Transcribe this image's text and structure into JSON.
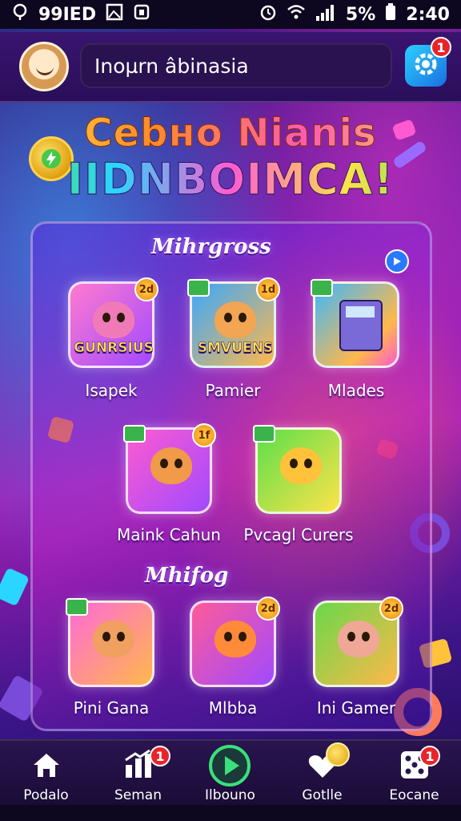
{
  "status_bar": {
    "left_text": "99IED",
    "battery_percent": "5%",
    "time": "2:40"
  },
  "header": {
    "search_value": "Inoµrn âbinasia",
    "settings_badge": "1"
  },
  "hero": {
    "title_line1": "Cebно Nianis",
    "title_line2": "IIDNBOIMCA!"
  },
  "panel": {
    "section1_title": "Mihrgross",
    "section2_title": "Mhifog",
    "games_row1": [
      {
        "label": "Isapek",
        "banner": "GUNRSIUS",
        "badge": "2d",
        "face": "#f07ab8",
        "bg": "#ff7ad0"
      },
      {
        "label": "Pamier",
        "banner": "SMVUENS",
        "badge": "1d",
        "face": "#f2a552",
        "bg": "#3aa8ff"
      },
      {
        "label": "Mlades",
        "banner": "",
        "badge": "",
        "face": "#7a6ad8",
        "bg": "#ffb84a"
      }
    ],
    "games_row2": [
      {
        "label": "Maink Cahun",
        "badge": "1f",
        "face": "#f09a4a",
        "bg": "#ff5ad0"
      },
      {
        "label": "Pvcagl Curers",
        "badge": "",
        "face": "#ffc23a",
        "bg": "#5ae04a"
      }
    ],
    "games_row3": [
      {
        "label": "Pini Gana",
        "badge": "",
        "face": "#f0a060",
        "bg": "#ff6ad8"
      },
      {
        "label": "Mlbba",
        "badge": "2d",
        "face": "#ff8a3a",
        "bg": "#ff5a9a"
      },
      {
        "label": "Ini Gamer",
        "badge": "2d",
        "face": "#f0a896",
        "bg": "#6ad84a"
      }
    ]
  },
  "bottom_nav": [
    {
      "label": "Podalo",
      "icon": "home-icon",
      "badge": ""
    },
    {
      "label": "Seman",
      "icon": "chart-icon",
      "badge": "1"
    },
    {
      "label": "Ilbouno",
      "icon": "play-icon",
      "badge": ""
    },
    {
      "label": "Gotlle",
      "icon": "heart-coin-icon",
      "badge": ""
    },
    {
      "label": "Eocane",
      "icon": "dice-icon",
      "badge": "1"
    }
  ],
  "colors": {
    "accent_cyan": "#2bd0ff",
    "badge_red": "#e8242a",
    "gold": "#ffd24a"
  }
}
